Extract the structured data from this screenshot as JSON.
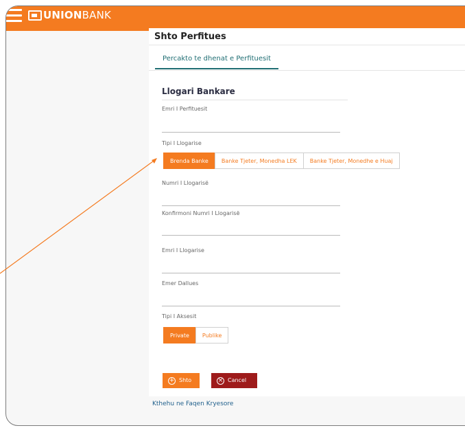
{
  "header": {
    "logo_bold": "UNION",
    "logo_light": "BANK"
  },
  "page": {
    "title": "Shto Perfitues",
    "tab_label": "Percakto te dhenat e Perfituesit",
    "section_title": "Llogari Bankare"
  },
  "form": {
    "beneficiary_name_label": "Emri I Perfituesit",
    "account_type_label": "Tipi I Llogarise",
    "account_type_options": [
      "Brenda Banke",
      "Banke Tjeter, Monedha LEK",
      "Banke Tjeter, Monedhe e Huaj"
    ],
    "account_number_label": "Numri I Llogarisë",
    "confirm_account_number_label": "Konfirmoni Numri I Llogarisë",
    "account_name_label": "Emri I Llogarise",
    "distinguishing_name_label": "Emer Dallues",
    "access_type_label": "Tipi I Aksesit",
    "access_type_options": [
      "Private",
      "Publike"
    ]
  },
  "actions": {
    "add_label": "Shto",
    "cancel_label": "Cancel"
  },
  "footer": {
    "back_link": "Kthehu ne Faqen Kryesore"
  },
  "colors": {
    "brand_orange": "#f47b20",
    "cancel_red": "#9e1b1b",
    "tab_teal": "#1f6e73",
    "arrow": "#f47b20"
  },
  "icons": [
    "hamburger-menu-icon",
    "unionbank-logo-icon",
    "plus-circle-icon",
    "x-circle-icon"
  ]
}
